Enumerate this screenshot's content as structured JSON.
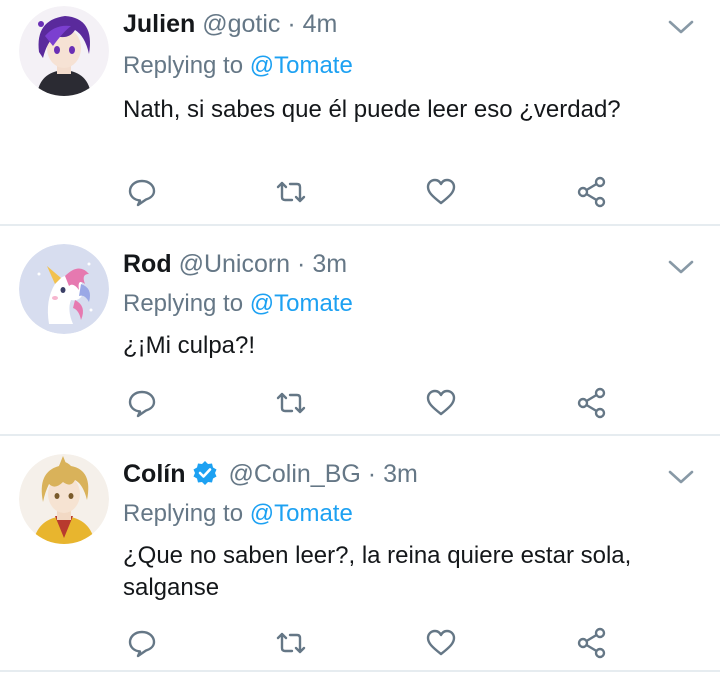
{
  "tweets": [
    {
      "name": "Julien",
      "handle": "@gotic",
      "dot": "·",
      "time": "4m",
      "verified": false,
      "replying_prefix": "Replying to ",
      "replying_to": "@Tomate",
      "text": "Nath, si sabes que él puede leer eso ¿verdad?",
      "avatar_icon": "anime-boy-purple-hair-avatar"
    },
    {
      "name": "Rod",
      "handle": "@Unicorn",
      "dot": "·",
      "time": "3m",
      "verified": false,
      "replying_prefix": "Replying to ",
      "replying_to": "@Tomate",
      "text": "¿¡Mi culpa?!",
      "avatar_icon": "unicorn-avatar"
    },
    {
      "name": "Colín",
      "handle": "@Colin_BG",
      "dot": "·",
      "time": "3m",
      "verified": true,
      "replying_prefix": "Replying to ",
      "replying_to": "@Tomate",
      "text": "¿Que no saben leer?, la reina quiere estar sola, salganse",
      "avatar_icon": "anime-boy-blonde-hair-avatar"
    }
  ],
  "colors": {
    "accent": "#1da1f2",
    "secondary_text": "#657786",
    "icon_gray": "#657786",
    "divider": "#e6ecf0"
  }
}
